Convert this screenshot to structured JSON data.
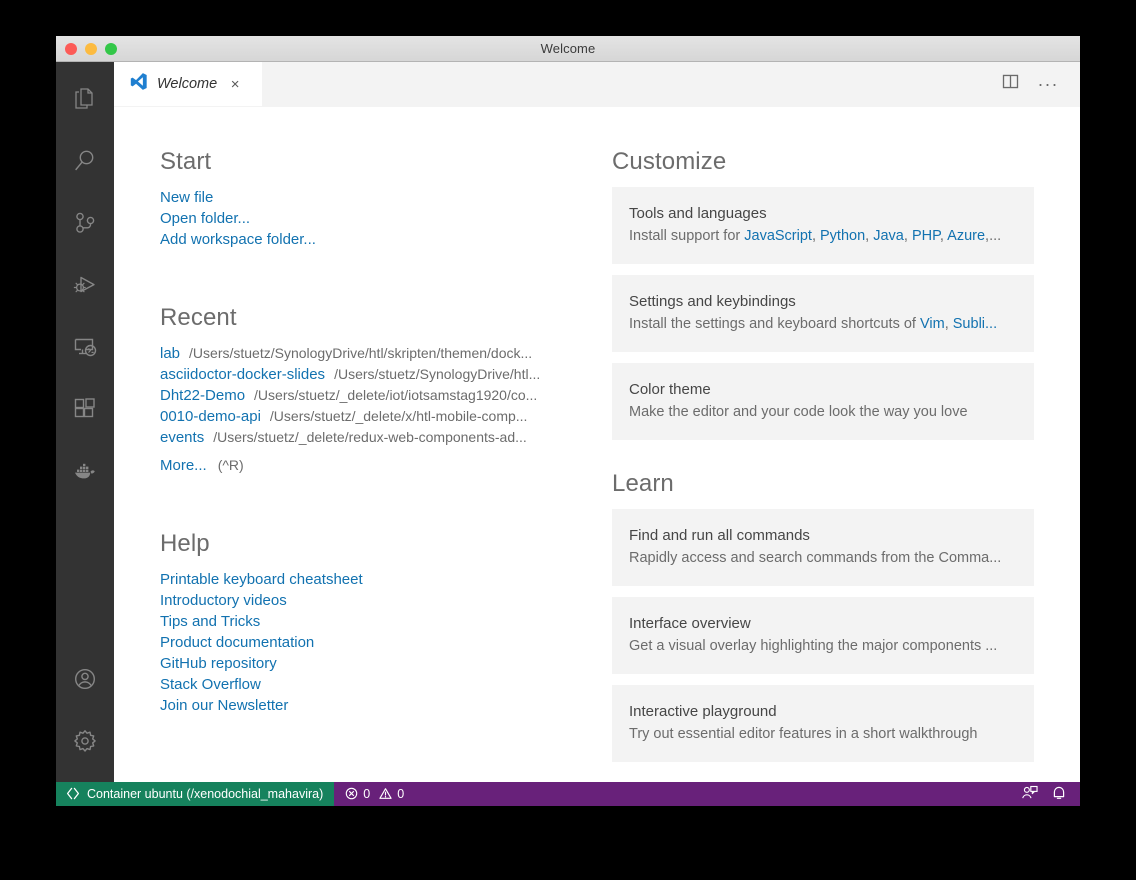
{
  "window": {
    "title": "Welcome",
    "traffic_lights": [
      "close-red",
      "minimize-yellow",
      "maximize-green"
    ]
  },
  "activity_bar": {
    "top_items": [
      {
        "name": "explorer",
        "label": "Explorer"
      },
      {
        "name": "search",
        "label": "Search"
      },
      {
        "name": "source-control",
        "label": "Source Control"
      },
      {
        "name": "run-and-debug",
        "label": "Run and Debug"
      },
      {
        "name": "remote-explorer",
        "label": "Remote Explorer"
      },
      {
        "name": "extensions",
        "label": "Extensions"
      },
      {
        "name": "docker",
        "label": "Docker"
      }
    ],
    "bottom_items": [
      {
        "name": "accounts",
        "label": "Accounts"
      },
      {
        "name": "manage-settings",
        "label": "Manage"
      }
    ]
  },
  "tabs": {
    "active": "Welcome",
    "items": [
      {
        "label": "Welcome",
        "icon": "vscode-logo-icon",
        "close": "×"
      }
    ],
    "actions": {
      "split_editor": "split-editor-icon",
      "more_actions": "···"
    }
  },
  "welcome": {
    "start": {
      "title": "Start",
      "links": [
        "New file",
        "Open folder...",
        "Add workspace folder..."
      ]
    },
    "recent": {
      "title": "Recent",
      "items": [
        {
          "name": "lab",
          "path": "/Users/stuetz/SynologyDrive/htl/skripten/themen/dock..."
        },
        {
          "name": "asciidoctor-docker-slides",
          "path": "/Users/stuetz/SynologyDrive/htl..."
        },
        {
          "name": "Dht22-Demo",
          "path": "/Users/stuetz/_delete/iot/iotsamstag1920/co..."
        },
        {
          "name": "0010-demo-api",
          "path": "/Users/stuetz/_delete/x/htl-mobile-comp..."
        },
        {
          "name": "events",
          "path": "/Users/stuetz/_delete/redux-web-components-ad..."
        }
      ],
      "more_label": "More...",
      "more_shortcut": "(^R)"
    },
    "help": {
      "title": "Help",
      "links": [
        "Printable keyboard cheatsheet",
        "Introductory videos",
        "Tips and Tricks",
        "Product documentation",
        "GitHub repository",
        "Stack Overflow",
        "Join our Newsletter"
      ]
    },
    "customize": {
      "title": "Customize",
      "cards": [
        {
          "title": "Tools and languages",
          "desc_prefix": "Install support for ",
          "desc_links": [
            "JavaScript",
            "Python",
            "Java",
            "PHP",
            "Azure"
          ],
          "desc_suffix": ",..."
        },
        {
          "title": "Settings and keybindings",
          "desc_prefix": "Install the settings and keyboard shortcuts of ",
          "desc_links": [
            "Vim",
            "Subli..."
          ],
          "desc_suffix": ""
        },
        {
          "title": "Color theme",
          "desc_prefix": "Make the editor and your code look the way you love",
          "desc_links": [],
          "desc_suffix": ""
        }
      ]
    },
    "learn": {
      "title": "Learn",
      "cards": [
        {
          "title": "Find and run all commands",
          "desc": "Rapidly access and search commands from the Comma..."
        },
        {
          "title": "Interface overview",
          "desc": "Get a visual overlay highlighting the major components ..."
        },
        {
          "title": "Interactive playground",
          "desc": "Try out essential editor features in a short walkthrough"
        }
      ]
    }
  },
  "status_bar": {
    "remote": {
      "icon": "remote-indicator-icon",
      "label": "Container ubuntu (/xenodochial_mahavira)",
      "background": "#16825d"
    },
    "problems": {
      "error_icon": "error-circle-icon",
      "error_count": "0",
      "warning_icon": "warning-triangle-icon",
      "warning_count": "0"
    },
    "right_icons": [
      {
        "name": "live-share-icon"
      },
      {
        "name": "bell-icon"
      }
    ],
    "background": "#68217a"
  }
}
